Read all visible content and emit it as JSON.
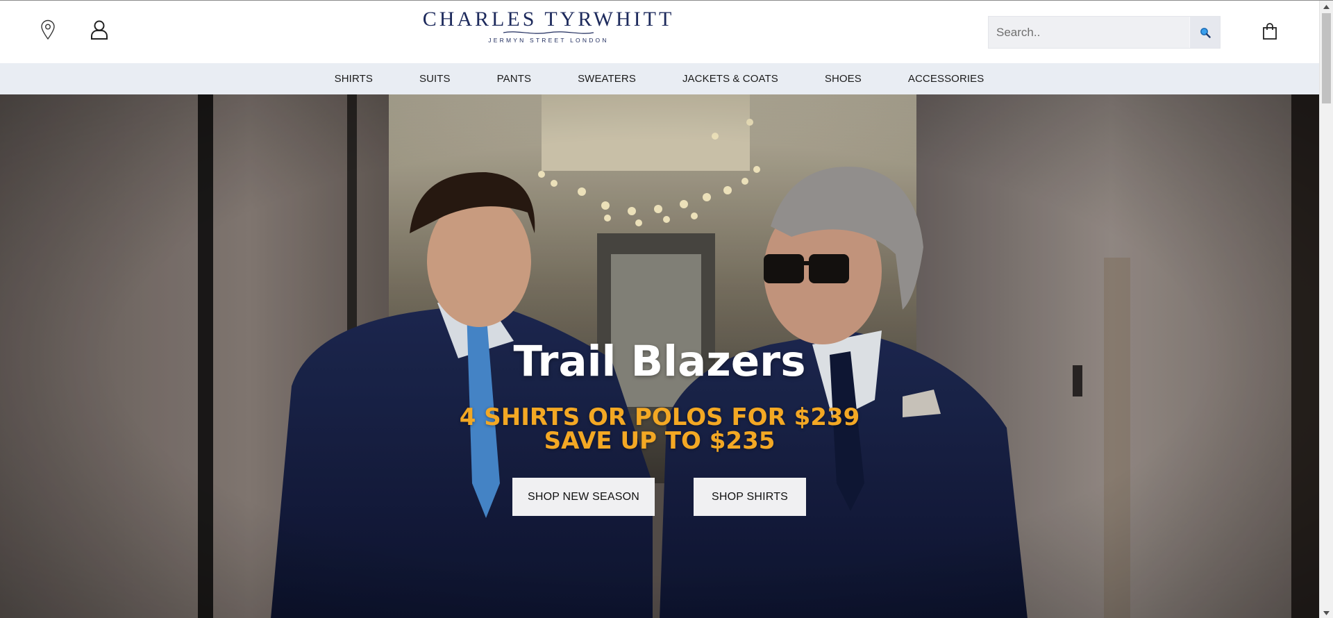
{
  "header": {
    "brand": "CHARLES TYRWHITT",
    "brand_sub": "JERMYN STREET LONDON",
    "search_placeholder": "Search..",
    "icons": [
      "location-pin-icon",
      "user-icon",
      "search-icon",
      "shopping-bag-icon"
    ]
  },
  "nav": {
    "items": [
      "SHIRTS",
      "SUITS",
      "PANTS",
      "SWEATERS",
      "JACKETS & COATS",
      "SHOES",
      "ACCESSORIES"
    ]
  },
  "hero": {
    "title": "Trail Blazers",
    "promo_line1": "4 SHIRTS OR POLOS FOR $239",
    "promo_line2": "SAVE UP TO $235",
    "cta_primary": "SHOP NEW SEASON",
    "cta_secondary": "SHOP SHIRTS"
  },
  "colors": {
    "brand_navy": "#1d2a5c",
    "nav_bg": "#e9edf3",
    "promo_orange": "#f3a824",
    "search_bg": "#eff0f3",
    "search_icon_blue": "#1f8be0"
  }
}
